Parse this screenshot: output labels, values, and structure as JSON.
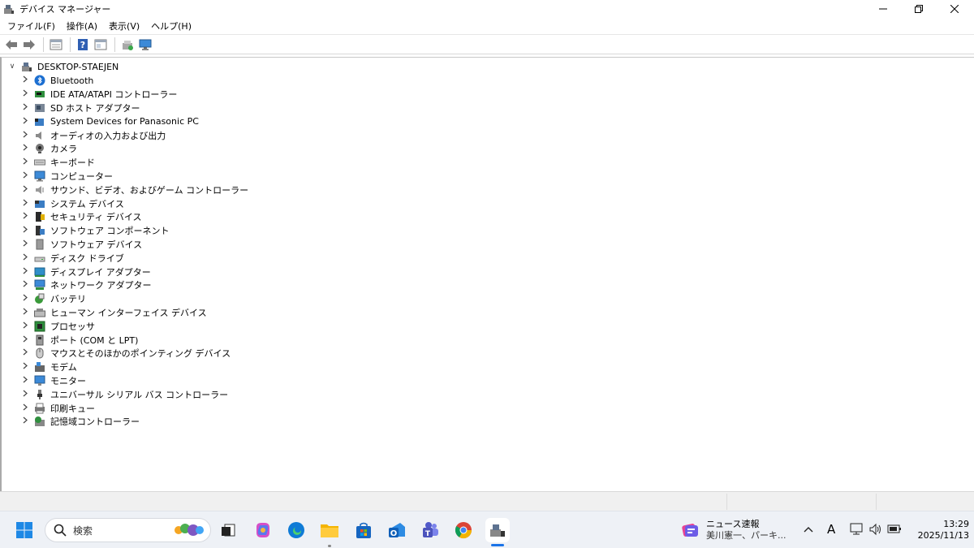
{
  "window": {
    "title": "デバイス マネージャー"
  },
  "menu": [
    "ファイル(F)",
    "操作(A)",
    "表示(V)",
    "ヘルプ(H)"
  ],
  "toolbar": {
    "buttons": [
      "back-arrow",
      "forward-arrow",
      "properties",
      "help",
      "show-hide",
      "update-driver",
      "scan-hardware"
    ]
  },
  "tree": {
    "root": "DESKTOP-STAEJEN",
    "items": [
      {
        "label": "Bluetooth",
        "icon": "bluetooth-icon"
      },
      {
        "label": "IDE ATA/ATAPI コントローラー",
        "icon": "ide-controller-icon"
      },
      {
        "label": "SD ホスト アダプター",
        "icon": "sd-host-icon"
      },
      {
        "label": "System Devices for Panasonic PC",
        "icon": "system-devices-icon"
      },
      {
        "label": "オーディオの入力および出力",
        "icon": "audio-icon"
      },
      {
        "label": "カメラ",
        "icon": "camera-icon"
      },
      {
        "label": "キーボード",
        "icon": "keyboard-icon"
      },
      {
        "label": "コンピューター",
        "icon": "computer-icon"
      },
      {
        "label": "サウンド、ビデオ、およびゲーム コントローラー",
        "icon": "sound-icon"
      },
      {
        "label": "システム デバイス",
        "icon": "system-device-icon"
      },
      {
        "label": "セキュリティ デバイス",
        "icon": "security-icon"
      },
      {
        "label": "ソフトウェア コンポーネント",
        "icon": "software-component-icon"
      },
      {
        "label": "ソフトウェア デバイス",
        "icon": "software-device-icon"
      },
      {
        "label": "ディスク ドライブ",
        "icon": "disk-drive-icon"
      },
      {
        "label": "ディスプレイ アダプター",
        "icon": "display-adapter-icon"
      },
      {
        "label": "ネットワーク アダプター",
        "icon": "network-adapter-icon"
      },
      {
        "label": "バッテリ",
        "icon": "battery-icon"
      },
      {
        "label": "ヒューマン インターフェイス デバイス",
        "icon": "hid-icon"
      },
      {
        "label": "プロセッサ",
        "icon": "processor-icon"
      },
      {
        "label": "ポート (COM と LPT)",
        "icon": "port-icon"
      },
      {
        "label": "マウスとそのほかのポインティング デバイス",
        "icon": "mouse-icon"
      },
      {
        "label": "モデム",
        "icon": "modem-icon"
      },
      {
        "label": "モニター",
        "icon": "monitor-icon"
      },
      {
        "label": "ユニバーサル シリアル バス コントローラー",
        "icon": "usb-icon"
      },
      {
        "label": "印刷キュー",
        "icon": "print-queue-icon"
      },
      {
        "label": "記憶域コントローラー",
        "icon": "storage-controller-icon"
      }
    ]
  },
  "taskbar": {
    "search_placeholder": "検索",
    "apps": [
      "start",
      "task-view",
      "copilot",
      "edge",
      "file-explorer",
      "microsoft-store",
      "outlook",
      "teams",
      "chrome",
      "device-manager"
    ],
    "news_title": "ニュース速報",
    "news_subtitle": "美川憲一、パーキ...",
    "ime": "A",
    "time": "13:29",
    "date": "2025/11/13"
  },
  "colors": {
    "accent": "#1a73e8",
    "folder": "#f4b400",
    "taskbar": "#eef1f6"
  }
}
